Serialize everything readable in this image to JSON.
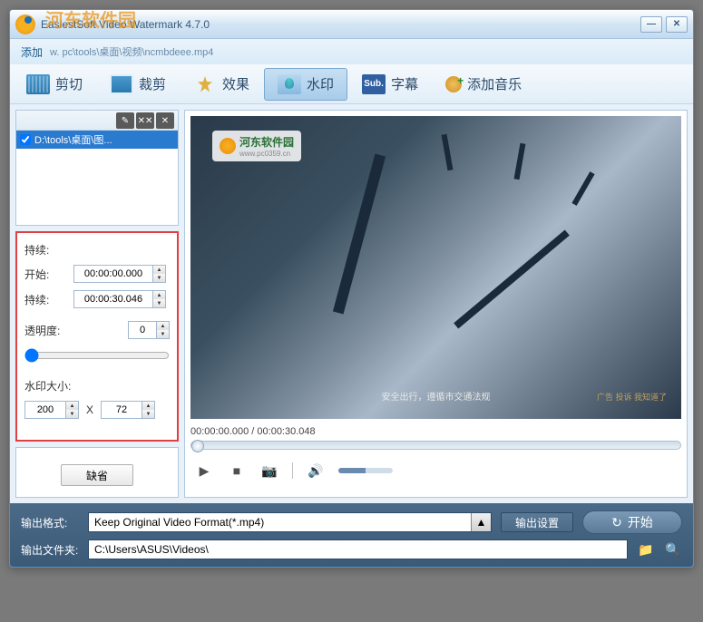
{
  "window": {
    "title": "EasiestSoft Video Watermark 4.7.0",
    "watermark_overlay": "河东软件园"
  },
  "titlebar_buttons": {
    "minimize": "—",
    "close": "✕"
  },
  "pathbar": {
    "add_label": "添加",
    "path": "w. pc\\tools\\桌面\\视频\\ncmbdeee.mp4"
  },
  "tabs": [
    {
      "label": "剪切",
      "icon": "film"
    },
    {
      "label": "裁剪",
      "icon": "crop"
    },
    {
      "label": "效果",
      "icon": "effect"
    },
    {
      "label": "水印",
      "icon": "watermark",
      "active": true
    },
    {
      "label": "字幕",
      "icon": "sub"
    },
    {
      "label": "添加音乐",
      "icon": "music"
    }
  ],
  "list": {
    "tools": [
      "✎",
      "✕✕",
      "✕"
    ],
    "item": "D:\\tools\\桌面\\图..."
  },
  "settings": {
    "duration_header": "持续:",
    "start_label": "开始:",
    "start_value": "00:00:00.000",
    "duration_label": "持续:",
    "duration_value": "00:00:30.046",
    "opacity_label": "透明度:",
    "opacity_value": "0",
    "size_label": "水印大小:",
    "width": "200",
    "x": "X",
    "height": "72"
  },
  "default_button": "缺省",
  "video": {
    "wm_text": "河东软件园",
    "wm_url": "www.pc0359.cn",
    "subtitle": "安全出行，遵循市交通法规",
    "corner": "广告 投诉 我知道了"
  },
  "timeline": {
    "current": "00:00:00.000",
    "total": "00:00:30.048"
  },
  "player": {
    "play": "▶",
    "stop": "■",
    "camera": "📷",
    "volume": "🔊"
  },
  "bottom": {
    "format_label": "输出格式:",
    "format_value": "Keep Original Video Format(*.mp4)",
    "output_settings": "输出设置",
    "start": "开始",
    "folder_label": "输出文件夹:",
    "folder_value": "C:\\Users\\ASUS\\Videos\\"
  }
}
